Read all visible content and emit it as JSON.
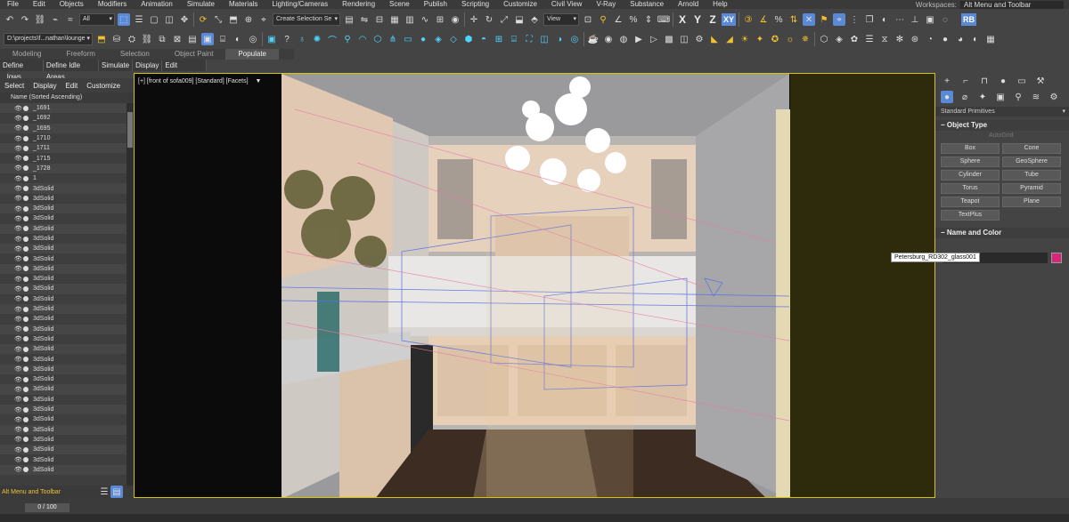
{
  "menubar": {
    "items": [
      "File",
      "Edit",
      "Objects",
      "Modifiers",
      "Animation",
      "Simulate",
      "Materials",
      "Lighting/Cameras",
      "Rendering",
      "Scene",
      "Publish",
      "Scripting",
      "Customize",
      "Civil View",
      "V-Ray",
      "Substance",
      "Arnold",
      "Help"
    ],
    "workspace_label": "Workspaces:",
    "workspace_value": "Alt Menu and Toolbar"
  },
  "toolbar": {
    "filter_value": "All",
    "selection_set_placeholder": "Create Selection Se",
    "coord_value": "View",
    "axes": [
      "X",
      "Y",
      "Z",
      "XY"
    ],
    "rb_label": "RB",
    "project_path": "D:\\projects\\f...nathan\\lounge"
  },
  "ribbon": {
    "tabs": [
      "Modeling",
      "Freeform",
      "Selection",
      "Object Paint",
      "Populate"
    ],
    "active_tab": "Populate",
    "sub_items": [
      "Define Flows",
      "Define Idle Areas",
      "Simulate",
      "Display",
      "Edit Selected"
    ]
  },
  "scene_explorer": {
    "menu": [
      "Select",
      "Display",
      "Edit",
      "Customize"
    ],
    "header": "Name (Sorted Ascending)",
    "rows": [
      "_1691",
      "_1692",
      "_1695",
      "_1710",
      "_1711",
      "_1715",
      "_1728",
      "1",
      "3dSolid",
      "3dSolid",
      "3dSolid",
      "3dSolid",
      "3dSolid",
      "3dSolid",
      "3dSolid",
      "3dSolid",
      "3dSolid",
      "3dSolid",
      "3dSolid",
      "3dSolid",
      "3dSolid",
      "3dSolid",
      "3dSolid",
      "3dSolid",
      "3dSolid",
      "3dSolid",
      "3dSolid",
      "3dSolid",
      "3dSolid",
      "3dSolid",
      "3dSolid",
      "3dSolid",
      "3dSolid",
      "3dSolid",
      "3dSolid",
      "3dSolid",
      "3dSolid"
    ],
    "footer_workspace": "Alt Menu and Toolbar"
  },
  "viewport": {
    "label": "[+] [front of sofa009] [Standard] [Facets]"
  },
  "command_panel": {
    "category": "Standard Primitives",
    "object_type_title": "Object Type",
    "autogrid": "AutoGrid",
    "buttons": [
      "Box",
      "Cone",
      "Sphere",
      "GeoSphere",
      "Cylinder",
      "Tube",
      "Torus",
      "Pyramid",
      "Teapot",
      "Plane",
      "TextPlus"
    ],
    "name_color_title": "Name and Color",
    "tooltip": "Petersburg_RD302_glass001",
    "object_color": "#d8267a"
  },
  "timeline": {
    "frame": "0 / 100"
  },
  "colors": {
    "accent": "#5a8ad6",
    "viewport_border": "#d8c400"
  }
}
